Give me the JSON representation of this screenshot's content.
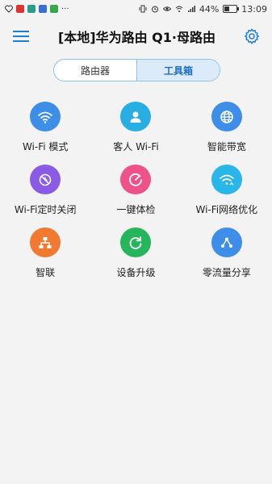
{
  "status_bar": {
    "battery": "44%",
    "time": "13:09"
  },
  "header": {
    "title": "[本地]华为路由 Q1·母路由"
  },
  "tabs": [
    {
      "label": "路由器",
      "active": false
    },
    {
      "label": "工具箱",
      "active": true
    }
  ],
  "tools": [
    {
      "label": "Wi-Fi 模式",
      "icon": "wifi-icon",
      "color": "#3d8ee8"
    },
    {
      "label": "客人 Wi-Fi",
      "icon": "guest-user-icon",
      "color": "#27aee3"
    },
    {
      "label": "智能带宽",
      "icon": "globe-icon",
      "color": "#3d8ee8"
    },
    {
      "label": "Wi-Fi定时关闭",
      "icon": "wifi-timer-icon",
      "color": "#8b5ae6"
    },
    {
      "label": "一键体检",
      "icon": "gauge-icon",
      "color": "#ee5289"
    },
    {
      "label": "Wi-Fi网络优化",
      "icon": "wifi-optimize-icon",
      "color": "#29b6e8"
    },
    {
      "label": "智联",
      "icon": "network-icon",
      "color": "#f07a2f"
    },
    {
      "label": "设备升级",
      "icon": "refresh-icon",
      "color": "#25b55a"
    },
    {
      "label": "零流量分享",
      "icon": "share-icon",
      "color": "#3d8ee8"
    }
  ]
}
